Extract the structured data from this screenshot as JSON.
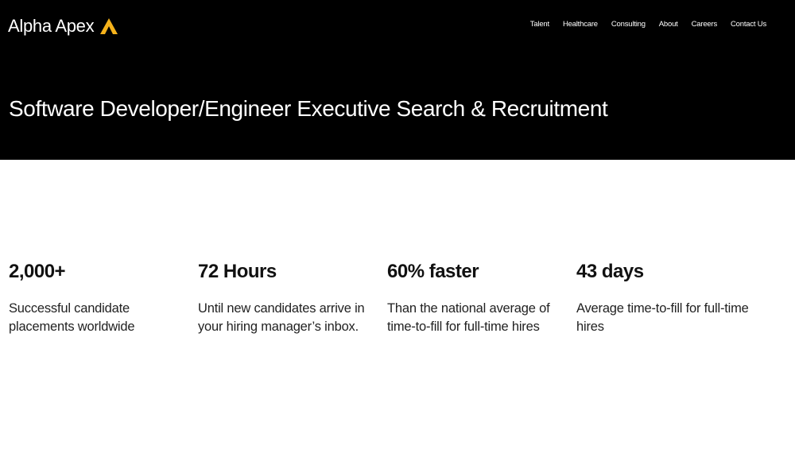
{
  "brand": {
    "name": "Alpha Apex",
    "icon": "triangle-logo-icon",
    "accent_color": "#F5B21B"
  },
  "nav": {
    "items": [
      {
        "label": "Talent"
      },
      {
        "label": "Healthcare"
      },
      {
        "label": "Consulting"
      },
      {
        "label": "About"
      },
      {
        "label": "Careers"
      },
      {
        "label": "Contact Us"
      }
    ]
  },
  "hero": {
    "title": "Software Developer/Engineer Executive Search & Recruitment"
  },
  "stats": [
    {
      "value": "2,000+",
      "description": "Successful candidate placements worldwide"
    },
    {
      "value": "72 Hours",
      "description": "Until new candidates arrive in your hiring manager’s inbox."
    },
    {
      "value": "60% faster",
      "description": "Than the national average of time-to-fill for full-time hires"
    },
    {
      "value": "43 days",
      "description": "Average time-to-fill for full-time hires"
    }
  ]
}
